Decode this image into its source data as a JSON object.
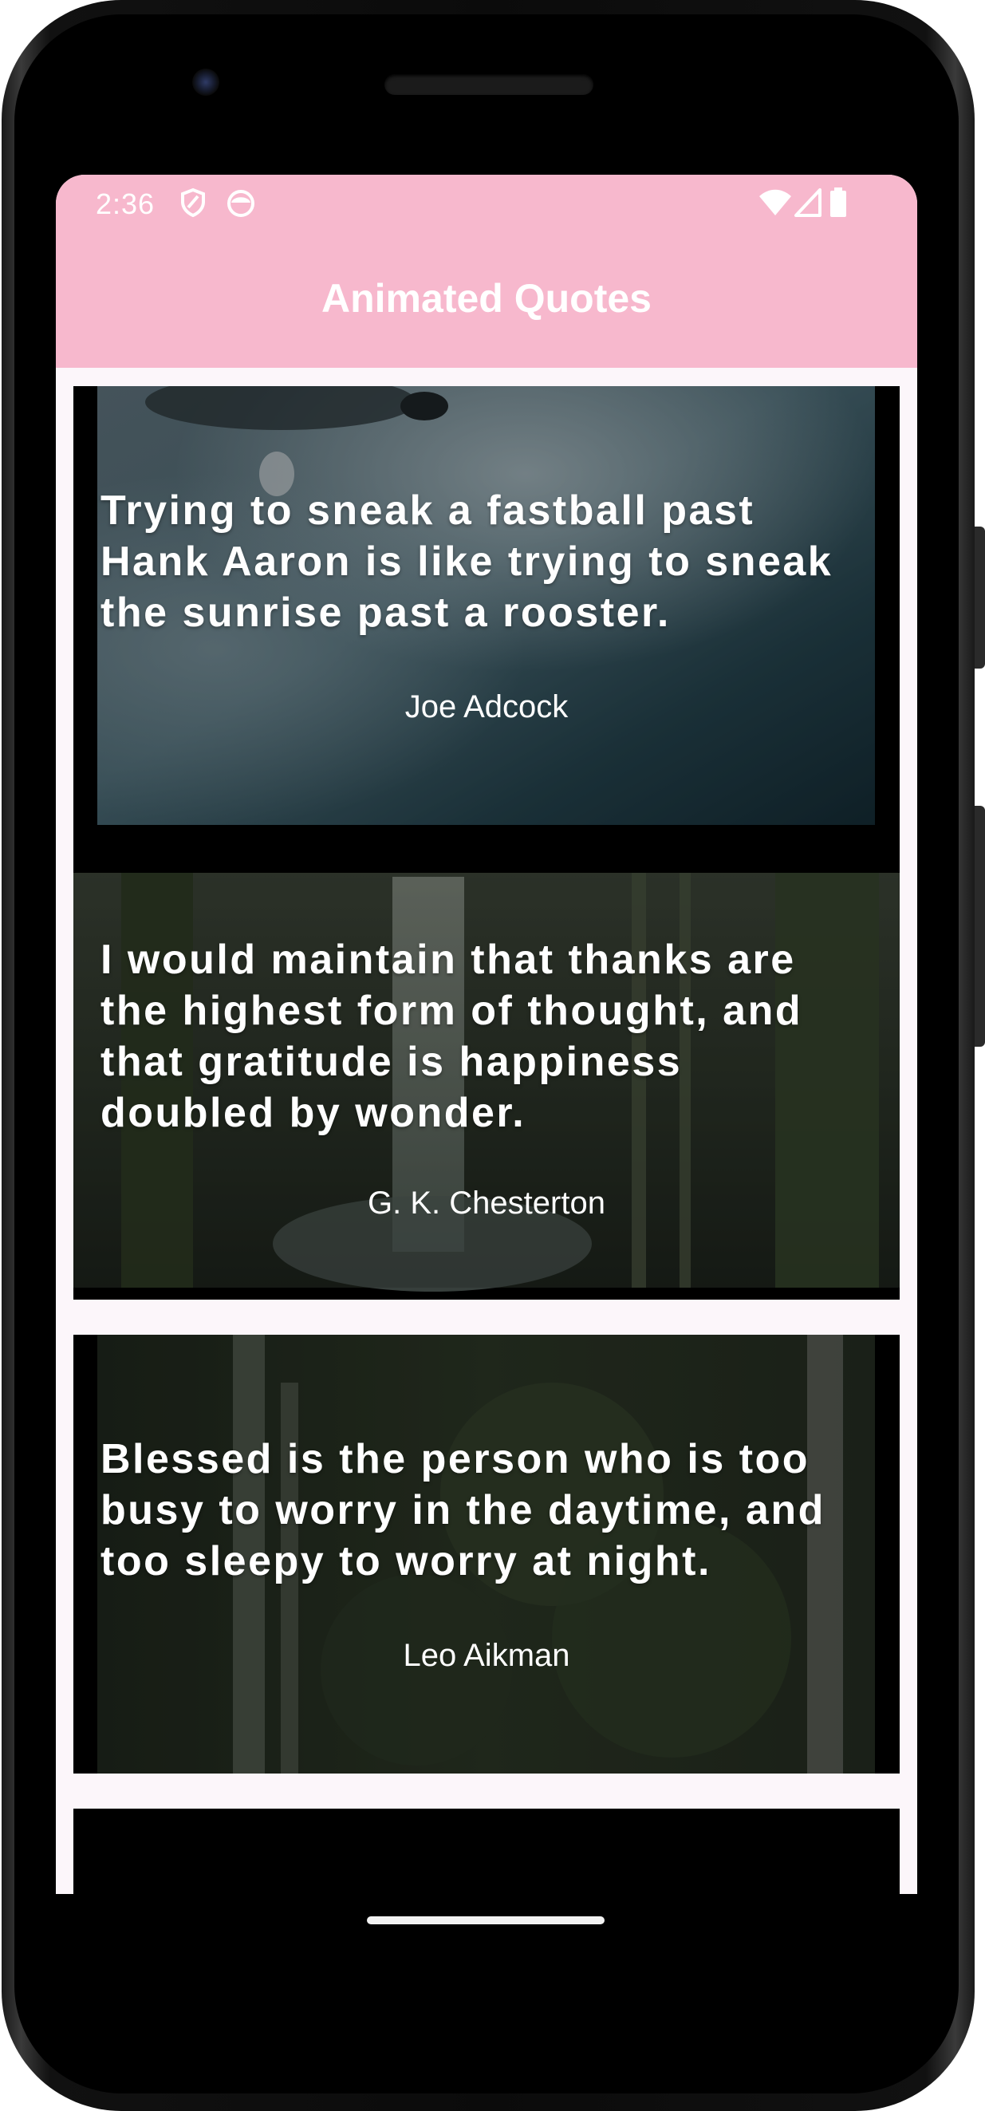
{
  "status_bar": {
    "time": "2:36",
    "left_icons": [
      "shield-icon",
      "app-face-icon"
    ],
    "right_icons": [
      "wifi-icon",
      "signal-icon",
      "battery-icon"
    ]
  },
  "app_bar": {
    "title": "Animated Quotes",
    "background_color": "#f7b8cd"
  },
  "quotes": [
    {
      "text": "Trying to sneak a fastball past Hank Aaron is like trying to sneak the sunrise past a rooster.",
      "author": "Joe Adcock",
      "background": "ocean-waves"
    },
    {
      "text": "I would maintain that thanks are the highest form of thought, and that gratitude is happiness doubled by wonder.",
      "author": "G. K. Chesterton",
      "background": "forest-waterfall"
    },
    {
      "text": "Blessed is the person who is too busy to worry in the daytime, and too sleepy to worry at night.",
      "author": "Leo Aikman",
      "background": "jungle-waterfall"
    }
  ]
}
